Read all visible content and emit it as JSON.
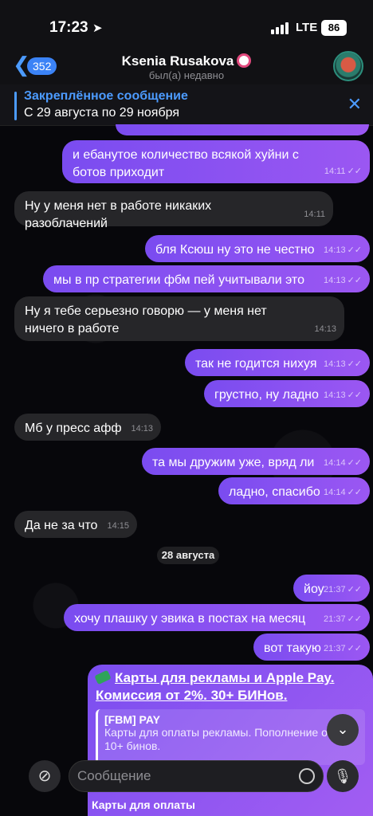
{
  "status": {
    "time": "17:23",
    "network": "LTE",
    "battery": "86"
  },
  "header": {
    "back_count": "352",
    "name": "Ksenia Rusakova",
    "status": "был(а) недавно"
  },
  "pinned": {
    "title": "Закреплённое сообщение",
    "text": "С 29 августа по 29 ноября"
  },
  "messages": [
    {
      "text": "и ебанутое количество всякой хуйни с ботов приходит",
      "time": "14:11"
    },
    {
      "text": "Ну у меня нет в работе никаких разоблачений",
      "time": "14:11"
    },
    {
      "text": "бля Ксюш ну это не честно",
      "time": "14:13"
    },
    {
      "text": "мы в пр стратегии фбм пей учитывали это",
      "time": "14:13"
    },
    {
      "text": "Ну я тебе серьезно говорю — у меня нет ничего в работе",
      "time": "14:13"
    },
    {
      "text": "так не годится нихуя",
      "time": "14:13"
    },
    {
      "text": "грустно, ну ладно",
      "time": "14:13"
    },
    {
      "text": "Мб у пресс афф",
      "time": "14:13"
    },
    {
      "text": "та мы дружим уже, вряд ли",
      "time": "14:14"
    },
    {
      "text": "ладно, спасибо",
      "time": "14:14"
    },
    {
      "text": "Да не за что",
      "time": "14:15"
    },
    {
      "text": "йоу",
      "time": "21:37"
    },
    {
      "text": "хочу плашку у эвика в постах на месяц",
      "time": "21:37"
    },
    {
      "text": "вот такую",
      "time": "21:37"
    }
  ],
  "date_separator": "28 августа",
  "card": {
    "title": "Карты для рекламы и Apple Pay. Комиссия от 2%. 30+ БИНов.",
    "preview_title": "[FBM] PAY",
    "preview_text": "Карты для оплаты рекламы. Пополнение от 2%. 10+ бинов.",
    "caption": "Карты для оплаты"
  },
  "composer": {
    "placeholder": "Сообщение"
  },
  "icons": {
    "back": "chevron-left-icon",
    "close": "close-icon",
    "attach": "paperclip-icon",
    "sticker": "sticker-icon",
    "mic": "microphone-icon",
    "scroll": "chevron-down-icon"
  },
  "colors": {
    "accent": "#4c9bff",
    "outgoing": "#8b52f1",
    "incoming": "#262629"
  }
}
